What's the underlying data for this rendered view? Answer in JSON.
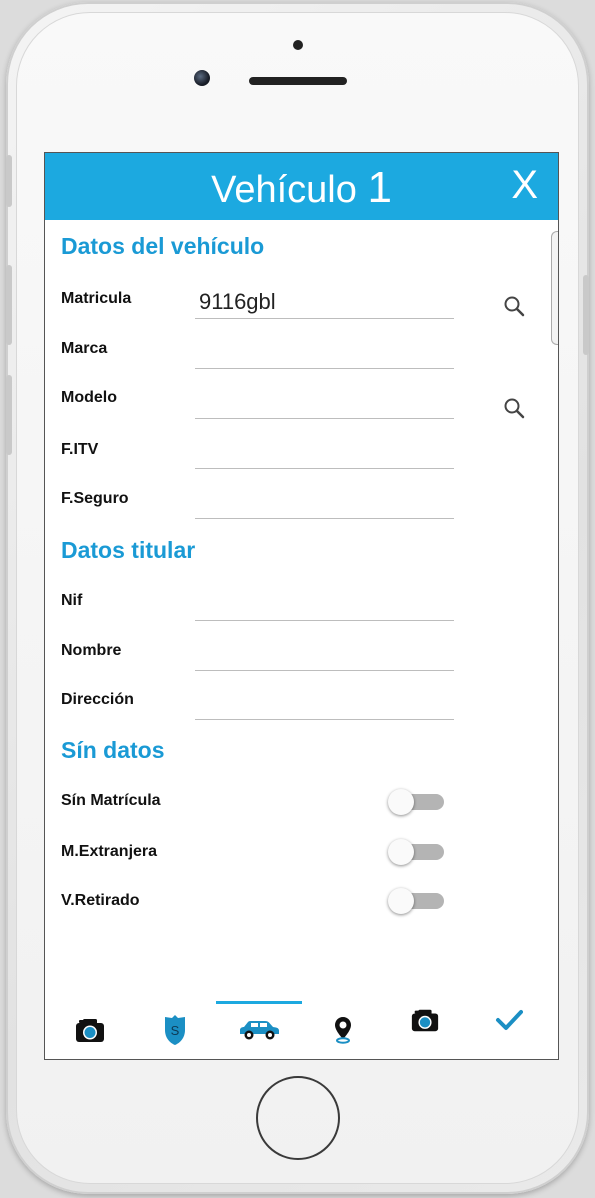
{
  "header": {
    "title": "Vehículo",
    "number": "1",
    "close_label": "X"
  },
  "vehicle_section": {
    "title": "Datos del vehículo",
    "fields": [
      {
        "label": "Matricula",
        "value": "9116gbl",
        "has_search": true
      },
      {
        "label": "Marca",
        "value": "",
        "has_search": false
      },
      {
        "label": "Modelo",
        "value": "",
        "has_search": true
      },
      {
        "label": "F.ITV",
        "value": "",
        "has_search": false
      },
      {
        "label": "F.Seguro",
        "value": "",
        "has_search": false
      }
    ]
  },
  "owner_section": {
    "title": "Datos titular",
    "fields": [
      {
        "label": "Nif",
        "value": ""
      },
      {
        "label": "Nombre",
        "value": ""
      },
      {
        "label": "Dirección",
        "value": ""
      }
    ]
  },
  "nodata_section": {
    "title": "Sín datos",
    "toggles": [
      {
        "label": "Sín Matrícula",
        "on": false
      },
      {
        "label": "M.Extranjera",
        "on": false
      },
      {
        "label": "V.Retirado",
        "on": false
      }
    ]
  },
  "tabbar": {
    "tabs": [
      {
        "icon": "camera-icon",
        "active": false
      },
      {
        "icon": "police-badge-icon",
        "active": false
      },
      {
        "icon": "car-icon",
        "active": true
      },
      {
        "icon": "location-pin-icon",
        "active": false
      },
      {
        "icon": "camera-icon",
        "active": false
      },
      {
        "icon": "checkmark-icon",
        "active": false
      }
    ]
  },
  "colors": {
    "accent": "#1ca9e0",
    "section_title": "#1a9ad5",
    "tab_icon": "#1b8fc4"
  }
}
